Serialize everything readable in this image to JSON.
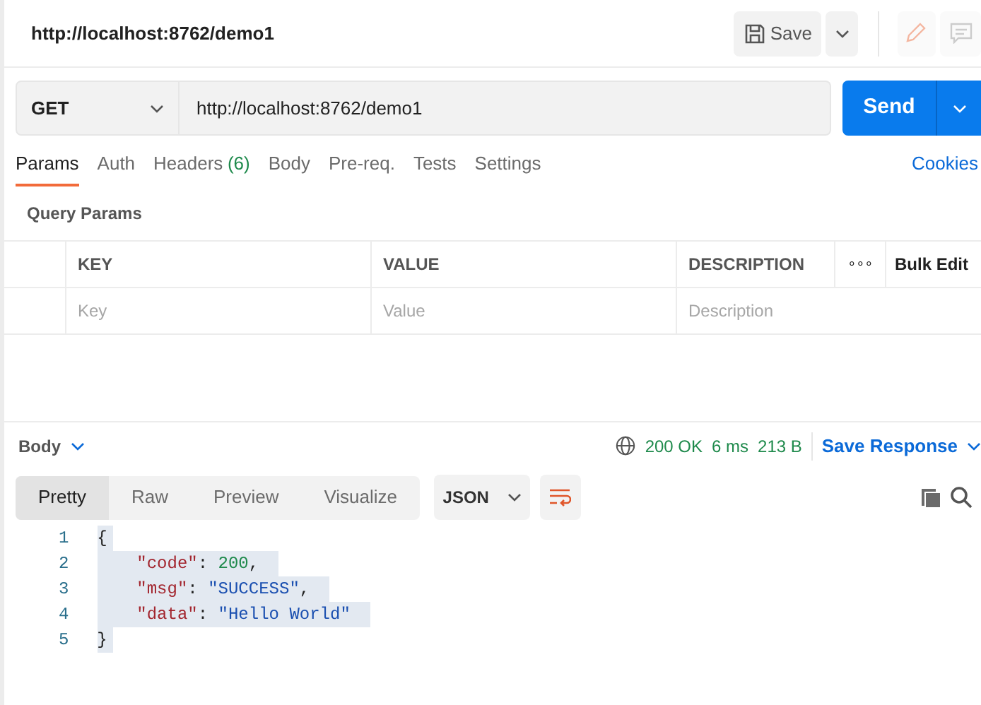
{
  "title": "http://localhost:8762/demo1",
  "save_button": "Save",
  "request": {
    "method": "GET",
    "url": "http://localhost:8762/demo1",
    "send": "Send"
  },
  "tabs": [
    {
      "label": "Params",
      "selected": true
    },
    {
      "label": "Auth",
      "selected": false
    },
    {
      "label": "Headers",
      "count": "(6)",
      "selected": false
    },
    {
      "label": "Body",
      "selected": false
    },
    {
      "label": "Pre-req.",
      "selected": false
    },
    {
      "label": "Tests",
      "selected": false
    },
    {
      "label": "Settings",
      "selected": false
    }
  ],
  "cookies_link": "Cookies",
  "query_params": {
    "title": "Query Params",
    "columns": [
      "KEY",
      "VALUE",
      "DESCRIPTION"
    ],
    "more": "∘∘∘",
    "bulk_edit": "Bulk Edit",
    "placeholders": [
      "Key",
      "Value",
      "Description"
    ]
  },
  "response": {
    "body_label": "Body",
    "status": "200 OK",
    "time": "6 ms",
    "size": "213 B",
    "save_response": "Save Response",
    "view_tabs": [
      {
        "label": "Pretty",
        "selected": true
      },
      {
        "label": "Raw",
        "selected": false
      },
      {
        "label": "Preview",
        "selected": false
      },
      {
        "label": "Visualize",
        "selected": false
      }
    ],
    "format": "JSON",
    "lines": [
      {
        "number": "1",
        "selected": true,
        "tokens": [
          {
            "kind": "punct",
            "text": "{"
          }
        ],
        "children": [
          {
            "number": "2",
            "selected": true,
            "tokens": [
              {
                "kind": "key",
                "text": "\"code\""
              },
              {
                "kind": "punct",
                "text": ": "
              },
              {
                "kind": "number",
                "text": "200"
              },
              {
                "kind": "punct",
                "text": ","
              }
            ]
          },
          {
            "number": "3",
            "selected": true,
            "tokens": [
              {
                "kind": "key",
                "text": "\"msg\""
              },
              {
                "kind": "punct",
                "text": ": "
              },
              {
                "kind": "string",
                "text": "\"SUCCESS\""
              },
              {
                "kind": "punct",
                "text": ","
              }
            ]
          },
          {
            "number": "4",
            "selected": true,
            "tokens": [
              {
                "kind": "key",
                "text": "\"data\""
              },
              {
                "kind": "punct",
                "text": ": "
              },
              {
                "kind": "string",
                "text": "\"Hello World\""
              }
            ]
          }
        ]
      },
      {
        "number": "5",
        "selected": true,
        "tokens": [
          {
            "kind": "punct",
            "text": "}"
          }
        ]
      }
    ]
  }
}
